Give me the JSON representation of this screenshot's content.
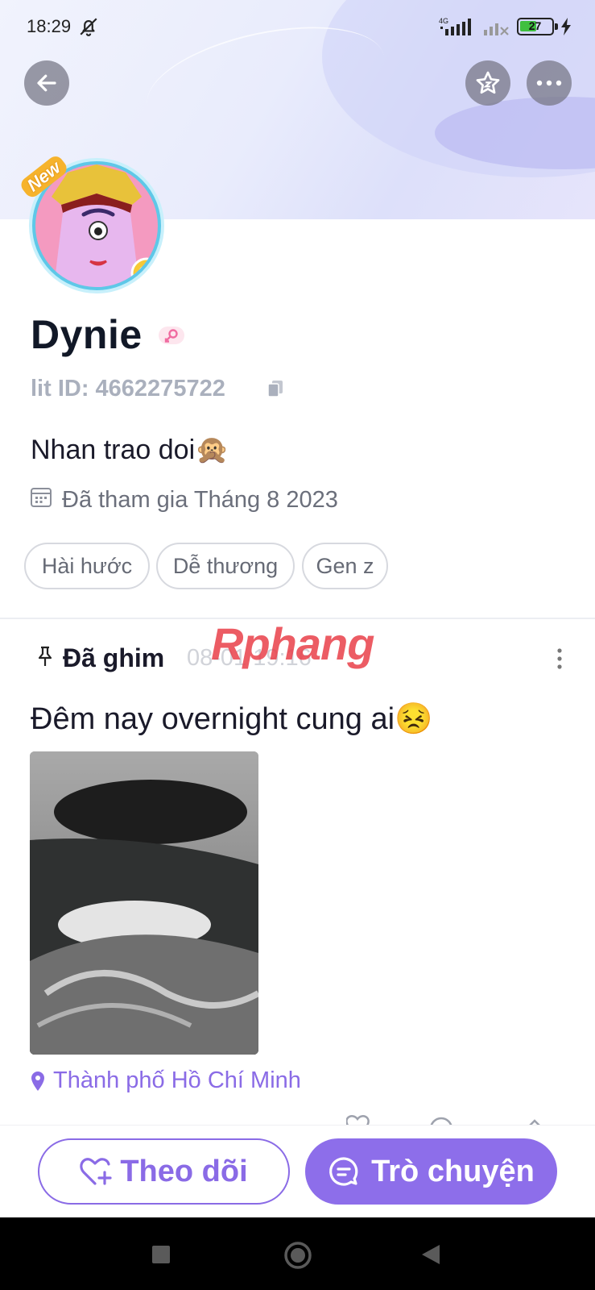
{
  "status_bar": {
    "time": "18:29",
    "network_label": "4G",
    "battery_level": "27",
    "icons": [
      "bell-off-icon",
      "signal-icon",
      "signal-weak-icon",
      "battery-icon",
      "charging-icon"
    ]
  },
  "header": {
    "back_icon": "arrow-left-icon",
    "favorite_icon": "star-icon",
    "more_icon": "more-horizontal-icon"
  },
  "profile": {
    "avatar_badge": "New",
    "name": "Dynie",
    "gender_icon": "female-icon",
    "lit_id": "lit ID: 4662275722",
    "bio": "Nhan trao doi🙊",
    "joined": "Đã tham gia Tháng 8 2023",
    "tags": [
      "Hài hước",
      "Dễ thương",
      "Gen z"
    ]
  },
  "pinned_post": {
    "pinned_label": "Đã ghim",
    "timestamp": "08-01 19:16",
    "watermark": "Rphang",
    "text": "Đêm nay overnight cung ai😣",
    "location": "Thành phố Hồ Chí Minh"
  },
  "actions": {
    "follow_label": "Theo dõi",
    "chat_label": "Trò chuyện"
  },
  "colors": {
    "accent": "#8d6eea",
    "tag_border": "#d7d9df",
    "muted_text": "#aab0bd"
  }
}
